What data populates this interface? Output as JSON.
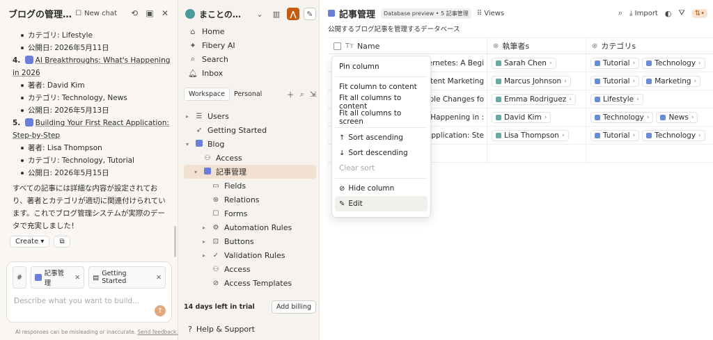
{
  "chat": {
    "title": "ブログの管理…",
    "new_chat": "New chat",
    "lines": [
      {
        "type": "bullet",
        "text": "カテゴリ: Lifestyle"
      },
      {
        "type": "bullet",
        "text": "公開日: 2026年5月11日"
      },
      {
        "type": "num",
        "num": "4.",
        "title": "AI Breakthroughs: What's Happening in 2026"
      },
      {
        "type": "bullet",
        "text": "著者: David Kim"
      },
      {
        "type": "bullet",
        "text": "カテゴリ: Technology, News"
      },
      {
        "type": "bullet",
        "text": "公開日: 2026年5月13日"
      },
      {
        "type": "num",
        "num": "5.",
        "title": "Building Your First React Application: Step-by-Step"
      },
      {
        "type": "bullet",
        "text": "著者: Lisa Thompson"
      },
      {
        "type": "bullet",
        "text": "カテゴリ: Technology, Tutorial"
      },
      {
        "type": "bullet",
        "text": "公開日: 2026年5月15日"
      }
    ],
    "summary": "すべての記事には詳細な内容が設定されており、著者とカテゴリが適切に関連付けられています。これでブログ管理システムが実際のデータで充実しました！",
    "create_label": "Create",
    "context_hash": "#",
    "context_chips": [
      "記事管理",
      "Getting Started"
    ],
    "placeholder": "Describe what you want to build...",
    "disclaimer": "AI responses can be misleading or inaccurate.",
    "feedback": "Send feedback."
  },
  "sidebar": {
    "workspace_name": "まことの…",
    "top_nav": [
      "Home",
      "Fibery AI",
      "Search",
      "Inbox"
    ],
    "tabs": [
      "Workspace",
      "Personal"
    ],
    "tree": [
      {
        "label": "Users",
        "level": 0,
        "caret": "▸",
        "icon": "db"
      },
      {
        "label": "Getting Started",
        "level": 0,
        "caret": "",
        "icon": "rocket"
      },
      {
        "label": "Blog",
        "level": 0,
        "caret": "▾",
        "icon": "db"
      },
      {
        "label": "Access",
        "level": 1,
        "caret": "",
        "icon": "people"
      },
      {
        "label": "記事管理",
        "level": 1,
        "caret": "▾",
        "icon": "db",
        "selected": true
      },
      {
        "label": "Fields",
        "level": 2,
        "caret": "",
        "icon": "fields"
      },
      {
        "label": "Relations",
        "level": 2,
        "caret": "",
        "icon": "relations"
      },
      {
        "label": "Forms",
        "level": 2,
        "caret": "",
        "icon": "forms"
      },
      {
        "label": "Automation Rules",
        "level": 2,
        "caret": "▸",
        "icon": "auto"
      },
      {
        "label": "Buttons",
        "level": 2,
        "caret": "▸",
        "icon": "button"
      },
      {
        "label": "Validation Rules",
        "level": 2,
        "caret": "▸",
        "icon": "check"
      },
      {
        "label": "Access",
        "level": 2,
        "caret": "",
        "icon": "people"
      },
      {
        "label": "Access Templates",
        "level": 2,
        "caret": "",
        "icon": "template"
      }
    ],
    "trial_text": "14 days left in trial",
    "billing_label": "Add billing",
    "help_label": "Help & Support"
  },
  "main": {
    "title": "記事管理",
    "badge": "Database preview • 5 記事管理",
    "views_label": "Views",
    "import_label": "Import",
    "subtitle": "公開するブログ記事を管理するデータベース",
    "columns": [
      "Name",
      "執筆者s",
      "カテゴリs"
    ],
    "rows": [
      {
        "name": "bernetes: A Begi",
        "author": "Sarah Chen",
        "cats": [
          "Tutorial",
          "Technology"
        ]
      },
      {
        "name": "Content Marketing",
        "author": "Marcus Johnson",
        "cats": [
          "Tutorial",
          "Marketing"
        ]
      },
      {
        "name": "Simple Changes fo",
        "author": "Emma Rodriguez",
        "cats": [
          "Lifestyle"
        ]
      },
      {
        "name": "t's Happening in :",
        "author": "David Kim",
        "cats": [
          "Technology",
          "News"
        ]
      },
      {
        "name": "ct Application: Ste",
        "author": "Lisa Thompson",
        "cats": [
          "Tutorial",
          "Technology"
        ]
      }
    ]
  },
  "menu": {
    "items": [
      {
        "label": "Pin column",
        "sep_after": true
      },
      {
        "label": "Fit column to content"
      },
      {
        "label": "Fit all columns to content"
      },
      {
        "label": "Fit all columns to screen",
        "sep_after": true
      },
      {
        "label": "Sort ascending",
        "icon": "↑"
      },
      {
        "label": "Sort descending",
        "icon": "↓"
      },
      {
        "label": "Clear sort",
        "disabled": true,
        "sep_after": true
      },
      {
        "label": "Hide column",
        "icon": "eye-off"
      },
      {
        "label": "Edit",
        "icon": "pencil",
        "hover": true
      }
    ]
  }
}
